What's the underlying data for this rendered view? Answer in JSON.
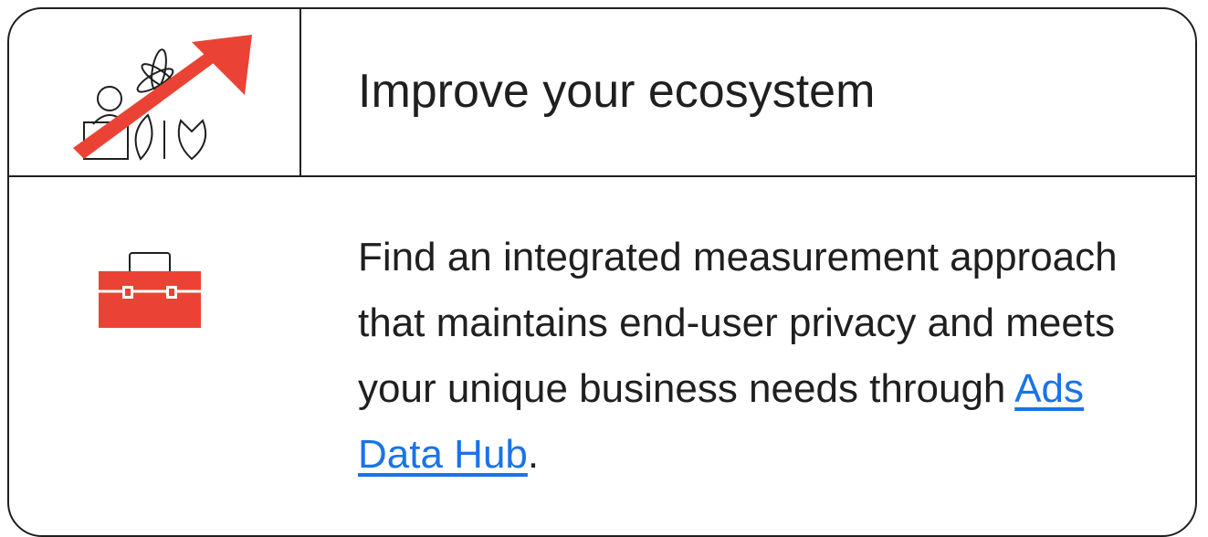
{
  "header": {
    "title": "Improve your ecosystem",
    "illustration_icon": "growth-arrow-icon"
  },
  "body": {
    "icon": "toolbox-icon",
    "text_before_link": "Find an integrated measurement approach that maintains end-user privacy and meets your unique business needs through ",
    "link_label": "Ads Data Hub",
    "text_after_link": "."
  },
  "colors": {
    "accent_red": "#ea4335",
    "link_blue": "#1a73e8",
    "text": "#1f1f1f",
    "border": "#1f1f1f"
  }
}
